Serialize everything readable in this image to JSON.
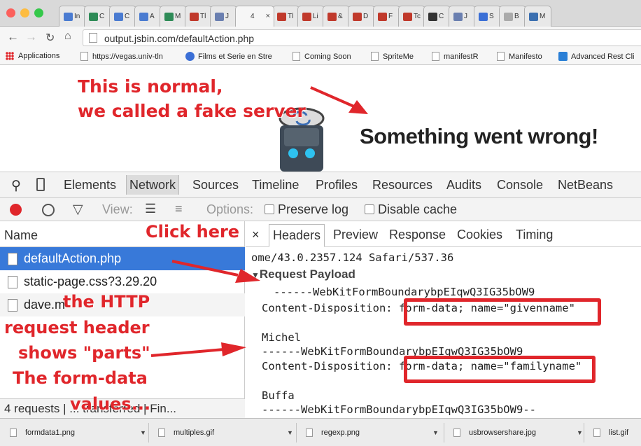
{
  "browser": {
    "tabs": [
      {
        "label": "In",
        "color": "#4a7bd1"
      },
      {
        "label": "C",
        "color": "#2e8b57"
      },
      {
        "label": "C",
        "color": "#4a7bd1"
      },
      {
        "label": "A",
        "color": "#4a7bd1"
      },
      {
        "label": "M",
        "color": "#2e8b57"
      },
      {
        "label": "Tl",
        "color": "#c0392b"
      },
      {
        "label": "J",
        "color": "#6a7fb0"
      },
      {
        "label": "4",
        "color": "#999999",
        "active": true
      },
      {
        "label": "Tl",
        "color": "#c0392b"
      },
      {
        "label": "Li",
        "color": "#c0392b"
      },
      {
        "label": "&",
        "color": "#c0392b"
      },
      {
        "label": "D",
        "color": "#c0392b"
      },
      {
        "label": "F",
        "color": "#c0392b"
      },
      {
        "label": "Tc",
        "color": "#c0392b"
      },
      {
        "label": "C",
        "color": "#333333"
      },
      {
        "label": "J",
        "color": "#6a7fb0"
      },
      {
        "label": "S",
        "color": "#3b6fd6"
      },
      {
        "label": "B",
        "color": "#aaaaaa"
      },
      {
        "label": "M",
        "color": "#3b6fb0"
      }
    ],
    "tab_close": "×",
    "url": "output.jsbin.com/defaultAction.php",
    "bookmarks": [
      "Applications",
      "https://vegas.univ-tln",
      "Films et Serie en Stre",
      "Coming Soon",
      "SpriteMe",
      "manifestR",
      "Manifesto",
      "Advanced Rest Cli"
    ]
  },
  "page": {
    "headline": "Something went wrong!"
  },
  "annotations": {
    "normal_line1": "This is normal,",
    "normal_line2": "we called a fake server",
    "click_here": "Click here",
    "http_line1": "the HTTP",
    "http_line2": "request header",
    "http_line3": "shows \"parts\"",
    "http_line4": "The form-data",
    "http_line5": "values..."
  },
  "devtools": {
    "tabs": [
      "Elements",
      "Network",
      "Sources",
      "Timeline",
      "Profiles",
      "Resources",
      "Audits",
      "Console",
      "NetBeans"
    ],
    "selected_tab": "Network",
    "view_label": "View:",
    "options_label": "Options:",
    "preserve_log": "Preserve log",
    "disable_cache": "Disable cache",
    "name_header": "Name",
    "files": [
      "defaultAction.php",
      "static-page.css?3.29.20",
      "dave.m"
    ],
    "status": "4 requests | ... transferred | Fin...",
    "detail_tabs": [
      "Headers",
      "Preview",
      "Response",
      "Cookies",
      "Timing"
    ],
    "close": "×",
    "user_agent_tail": "ome/43.0.2357.124 Safari/537.36",
    "payload_title": "Request Payload",
    "payload_lines": [
      "------WebKitFormBoundarybpEIqwQ3IG35bOW9",
      "Content-Disposition: form-data; name=\"givenname\"",
      "Michel",
      "------WebKitFormBoundarybpEIqwQ3IG35bOW9",
      "Content-Disposition: form-data; name=\"familyname\"",
      "Buffa",
      "------WebKitFormBoundarybpEIqwQ3IG35bOW9--"
    ]
  },
  "downloads": [
    "formdata1.png",
    "multiples.gif",
    "regexp.png",
    "usbrowsershare.jpg",
    "list.gif"
  ],
  "colors": {
    "annotation": "#e0262b",
    "selection": "#3879d9"
  }
}
